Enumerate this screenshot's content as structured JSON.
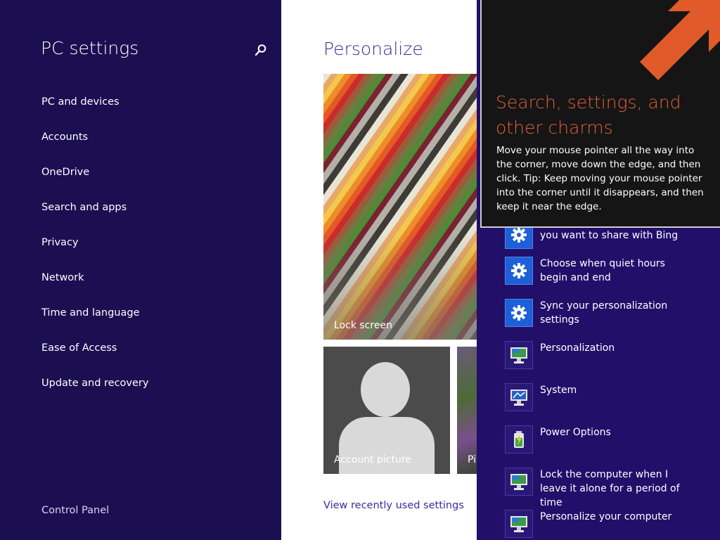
{
  "sidebar": {
    "title": "PC settings",
    "search_icon": "search-icon",
    "items": [
      {
        "label": "PC and devices"
      },
      {
        "label": "Accounts"
      },
      {
        "label": "OneDrive"
      },
      {
        "label": "Search and apps"
      },
      {
        "label": "Privacy"
      },
      {
        "label": "Network"
      },
      {
        "label": "Time and language"
      },
      {
        "label": "Ease of Access"
      },
      {
        "label": "Update and recovery"
      }
    ],
    "footer_link": "Control Panel"
  },
  "main": {
    "title": "Personalize",
    "tiles": {
      "lock_screen": "Lock screen",
      "account_picture": "Account picture",
      "picture_password": "Pi"
    },
    "recent_link": "View recently used settings"
  },
  "results": [
    {
      "icon": "gear-icon",
      "text": "you want to share with Bing"
    },
    {
      "icon": "gear-icon",
      "text": "Choose when quiet hours begin and end"
    },
    {
      "icon": "gear-icon",
      "text": "Sync your personalization settings"
    },
    {
      "icon": "monitor-icon",
      "text": "Personalization"
    },
    {
      "icon": "system-monitor-icon",
      "text": "System"
    },
    {
      "icon": "battery-icon",
      "text": "Power Options"
    },
    {
      "icon": "monitor-icon",
      "text": "Lock the computer when I leave it alone for a period of time"
    },
    {
      "icon": "monitor-icon",
      "text": "Personalize your computer"
    }
  ],
  "tooltip": {
    "title": "Search, settings, and other charms",
    "body": "Move your mouse pointer all the way into the corner, move down the edge, and then click. Tip: Keep moving your mouse pointer into the corner until it disappears, and then keep it near the edge."
  },
  "colors": {
    "sidebar_bg": "#1b0f52",
    "results_bg": "#220f6a",
    "accent_text": "#3d2a9a",
    "tooltip_title": "#e0603a",
    "arrow": "#e05a2a"
  }
}
